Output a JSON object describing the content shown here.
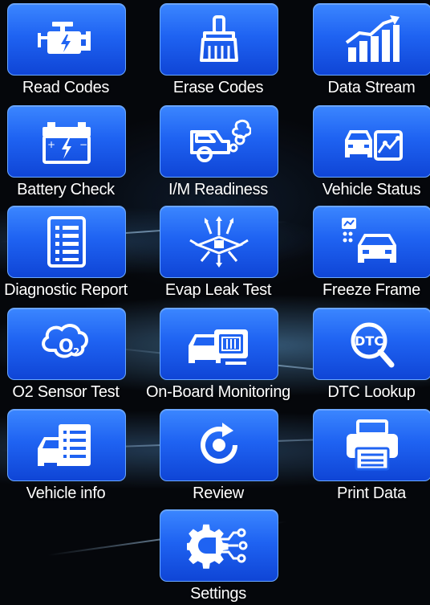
{
  "menu": {
    "items": [
      {
        "label": "Read Codes",
        "icon": "engine-icon"
      },
      {
        "label": "Erase Codes",
        "icon": "broom-icon"
      },
      {
        "label": "Data Stream",
        "icon": "bar-chart-icon"
      },
      {
        "label": "Battery Check",
        "icon": "battery-icon"
      },
      {
        "label": "I/M Readiness",
        "icon": "emissions-car-icon"
      },
      {
        "label": "Vehicle Status",
        "icon": "car-status-icon"
      },
      {
        "label": "Diagnostic Report",
        "icon": "report-list-icon"
      },
      {
        "label": "Evap Leak Test",
        "icon": "evap-leak-icon"
      },
      {
        "label": "Freeze Frame",
        "icon": "freeze-frame-car-icon"
      },
      {
        "label": "O2 Sensor Test",
        "icon": "o2-sensor-icon"
      },
      {
        "label": "On-Board Monitoring",
        "icon": "onboard-monitor-icon"
      },
      {
        "label": "DTC Lookup",
        "icon": "dtc-search-icon"
      },
      {
        "label": "Vehicle info",
        "icon": "vehicle-info-icon"
      },
      {
        "label": "Review",
        "icon": "review-icon"
      },
      {
        "label": "Print Data",
        "icon": "printer-icon"
      },
      {
        "label": "Settings",
        "icon": "settings-gear-icon"
      }
    ],
    "icon_glyph_text": {
      "o2": "O",
      "o2_sub": "2",
      "dtc": "DTC"
    }
  },
  "colors": {
    "tile_top": "#3b86ff",
    "tile_bottom": "#0f45d6",
    "tile_border": "#6aa8ff",
    "label": "#ffffff",
    "background": "#05070b"
  }
}
